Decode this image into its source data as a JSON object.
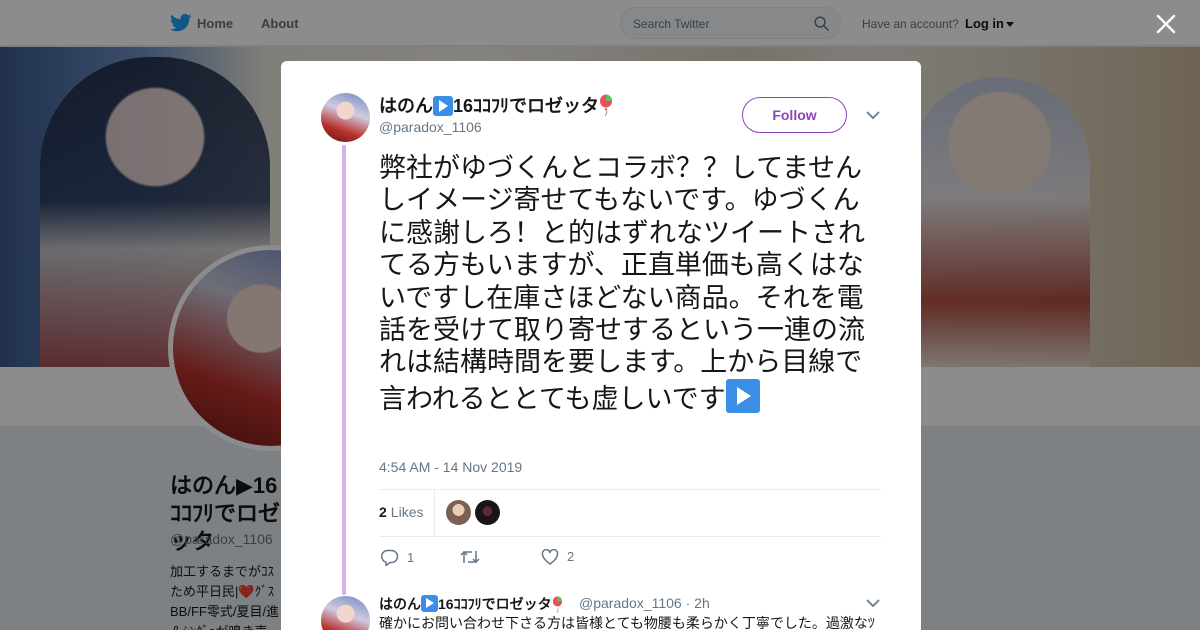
{
  "header": {
    "nav_home": "Home",
    "nav_about": "About",
    "search_placeholder": "Search Twitter",
    "account_prompt": "Have an account?",
    "login_label": "Log in"
  },
  "profile": {
    "name": "はのん▶16ｺｺﾌﾘでロゼッタ",
    "handle": "@paradox_1106",
    "bio": "加工するまでがｺｽ ため平日民|❤️ｸﾞｽ BB/FF零式/夏目/進 ＆ｼﾝｸﾞｮが鳴き声"
  },
  "tweet": {
    "author_name": "はのん",
    "author_name_suffix": "16ｺｺﾌﾘでロゼッタ",
    "author_handle": "@paradox_1106",
    "follow_label": "Follow",
    "text": "弊社がゆづくんとコラボ？？してませんしイメージ寄せてもないです。ゆづくんに感謝しろ！と的はずれなツイートされてる方もいますが、正直単価も高くはないですし在庫さほどない商品。それを電話を受けて取り寄せするという一連の流れは結構時間を要します。上から目線で言われるととても虚しいです",
    "timestamp": "4:54 AM - 14 Nov 2019",
    "likes_count": "2",
    "likes_label": "Likes",
    "reply_count": "1",
    "retweet_count": "",
    "like_count": "2"
  },
  "reply": {
    "author_name": "はのん",
    "author_name_suffix": "16ｺｺﾌﾘでロゼッタ",
    "author_handle": "@paradox_1106",
    "time_sep": "·",
    "time": "2h",
    "text": "確かにお問い合わせ下さる方は皆様とても物腰も柔らかく丁寧でした。過激なﾂ"
  },
  "colors": {
    "accent": "#8e44b8",
    "thread_line": "#d7b0ec",
    "twitter_blue": "#1da1f2",
    "play_emoji": "#3b8ee5"
  },
  "icons": [
    "twitter-bird-icon",
    "search-icon",
    "close-icon",
    "chevron-down-icon",
    "play-button-icon",
    "balloon-icon",
    "reply-icon",
    "retweet-icon",
    "heart-icon"
  ]
}
